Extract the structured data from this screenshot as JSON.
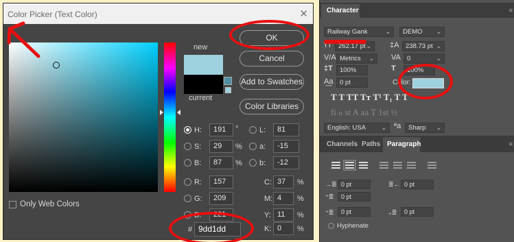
{
  "dialog": {
    "title": "Color Picker (Text Color)",
    "close_glyph": "✕",
    "new_label": "new",
    "current_label": "current",
    "new_color": "#9dd1dd",
    "current_color": "#000000",
    "buttons": {
      "ok": "OK",
      "cancel": "Cancel",
      "add_to_swatches": "Add to Swatches",
      "color_libraries": "Color Libraries"
    },
    "only_web_colors": "Only Web Colors",
    "hsb": [
      {
        "label": "H:",
        "value": "191",
        "unit": "°",
        "selected": true
      },
      {
        "label": "S:",
        "value": "29",
        "unit": "%"
      },
      {
        "label": "B:",
        "value": "87",
        "unit": "%"
      }
    ],
    "rgb": [
      {
        "label": "R:",
        "value": "157"
      },
      {
        "label": "G:",
        "value": "209"
      },
      {
        "label": "B:",
        "value": "221"
      }
    ],
    "lab": [
      {
        "label": "L:",
        "value": "81"
      },
      {
        "label": "a:",
        "value": "-15"
      },
      {
        "label": "b:",
        "value": "-12"
      }
    ],
    "cmyk": [
      {
        "label": "C:",
        "value": "37",
        "unit": "%"
      },
      {
        "label": "M:",
        "value": "4",
        "unit": "%"
      },
      {
        "label": "Y:",
        "value": "11",
        "unit": "%"
      },
      {
        "label": "K:",
        "value": "0",
        "unit": "%"
      }
    ],
    "hex_hash": "#",
    "hex_value": "9dd1dd"
  },
  "character_panel": {
    "tab": "Character",
    "font_family": "Railway Gank",
    "font_style": "DEMO",
    "font_size": "262.17 pt",
    "leading": "238.73 pt",
    "kerning_label": "V/A",
    "kerning": "Metrics",
    "tracking_label": "VA",
    "tracking": "0",
    "vscale": "100%",
    "hscale": "100%",
    "baseline": "0 pt",
    "color_label": "Color:",
    "text_color": "#9dd1dd",
    "style_buttons": "T  T  TT  Tт  T¹  T₁  T  T",
    "opentype_buttons": "fi  ℴ  st  A  aa  T  1st  ½",
    "language": "English: USA",
    "aa_icon": "ªa",
    "antialias": "Sharp"
  },
  "paragraph_panel": {
    "tabs": [
      "Channels",
      "Paths",
      "Paragraph"
    ],
    "indent_left": "0 pt",
    "indent_right": "0 pt",
    "first_line": "0 pt",
    "space_before": "0 pt",
    "space_after": "0 pt",
    "hyphenate": "Hyphenate"
  },
  "annotation_color": "#e81010"
}
